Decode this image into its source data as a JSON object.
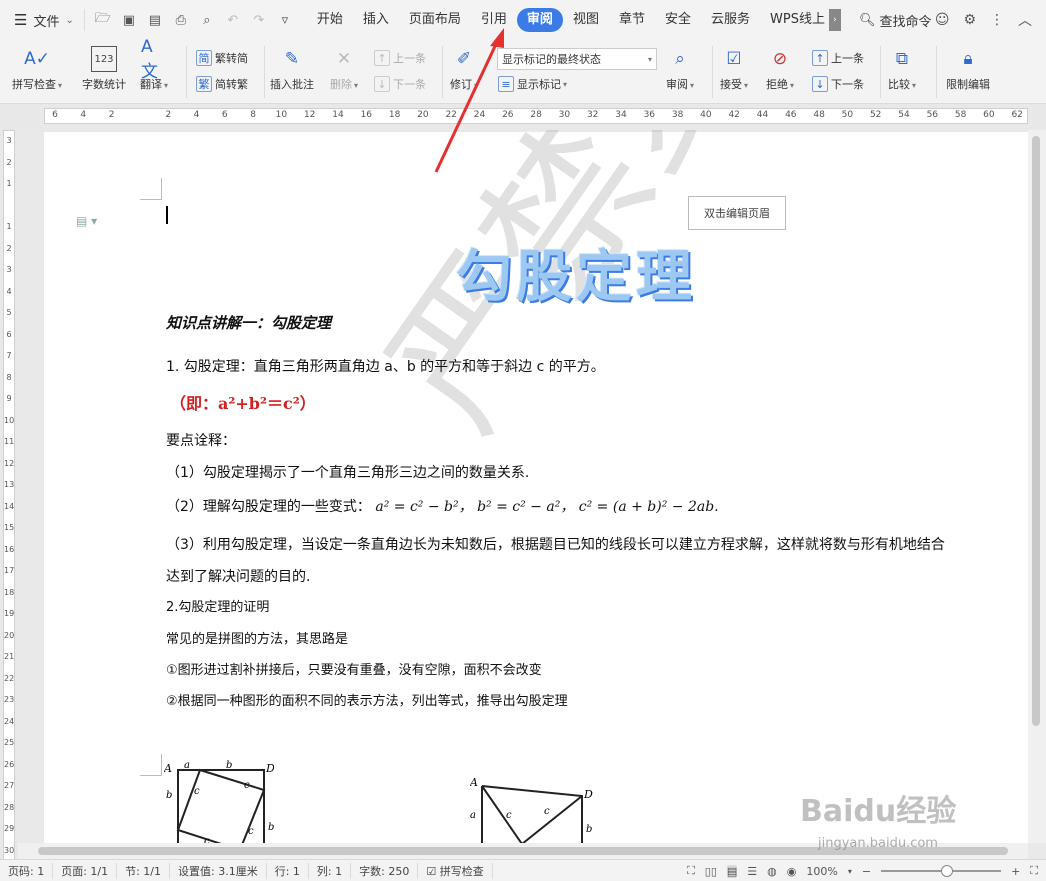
{
  "menubar": {
    "file_label": "文件",
    "tabs": [
      "开始",
      "插入",
      "页面布局",
      "引用",
      "审阅",
      "视图",
      "章节",
      "安全",
      "云服务",
      "WPS线上"
    ],
    "active_tab": "审阅",
    "search_label": "查找命令"
  },
  "ribbon": {
    "spell_check": "拼写检查",
    "word_count": "字数统计",
    "translate": "翻译",
    "trad_to_simp": "繁转简",
    "simp_to_trad": "简转繁",
    "insert_comment": "插入批注",
    "delete": "删除",
    "prev_item": "上一条",
    "next_item": "下一条",
    "track_changes": "修订",
    "display_mode": "显示标记的最终状态",
    "show_markup": "显示标记",
    "review": "审阅",
    "accept": "接受",
    "reject": "拒绝",
    "prev_change": "上一条",
    "next_change": "下一条",
    "compare": "比较",
    "restrict_edit": "限制编辑"
  },
  "ruler": {
    "h_ticks": [
      "6",
      "4",
      "2",
      "",
      "2",
      "4",
      "6",
      "8",
      "10",
      "12",
      "14",
      "16",
      "18",
      "20",
      "22",
      "24",
      "26",
      "28",
      "30",
      "32",
      "34",
      "36",
      "38",
      "40",
      "42",
      "44",
      "46",
      "48",
      "50",
      "52",
      "54",
      "56",
      "58",
      "60",
      "62"
    ],
    "v_ticks": [
      "3",
      "2",
      "1",
      "",
      "1",
      "2",
      "3",
      "4",
      "5",
      "6",
      "7",
      "8",
      "9",
      "10",
      "11",
      "12",
      "13",
      "14",
      "15",
      "16",
      "17",
      "18",
      "19",
      "20",
      "21",
      "22",
      "23",
      "24",
      "25",
      "26",
      "27",
      "28",
      "29",
      "30"
    ]
  },
  "document": {
    "header_button": "双击编辑页眉",
    "title": "勾股定理",
    "heading": "知识点讲解一：勾股定理",
    "p1": "1. 勾股定理：直角三角形两直角边 a、b 的平方和等于斜边 c 的平方。",
    "formula": "（即：a²+b²＝c²）",
    "notes_title": "要点诠释：",
    "note1": "（1）勾股定理揭示了一个直角三角形三边之间的数量关系.",
    "note2_prefix": "（2）理解勾股定理的一些变式：",
    "note2_math": "a² = c² − b²，  b² = c² − a²，   c² = (a + b)² − 2ab.",
    "note3_line1": "（3）利用勾股定理，当设定一条直角边长为未知数后，根据题目已知的线段长可以建立方程求解，这样就将数与形有机地结合",
    "note3_line2": "达到了解决问题的目的.",
    "p2": "2.勾股定理的证明",
    "p3": "常见的是拼图的方法，其思路是",
    "p4": "①图形进过割补拼接后，只要没有重叠，没有空隙，面积不会改变",
    "p5": "②根据同一种图形的面积不同的表示方法，列出等式，推导出勾股定理",
    "watermark": "严禁复制",
    "fig1_labels": [
      "A",
      "a",
      "b",
      "D",
      "b",
      "c",
      "c",
      "c",
      "c",
      "b",
      "a"
    ],
    "fig2_labels": [
      "A",
      "D",
      "a",
      "c",
      "c",
      "b"
    ]
  },
  "statusbar": {
    "page_num": "页码: 1",
    "pages": "页面: 1/1",
    "section": "节: 1/1",
    "setting": "设置值: 3.1厘米",
    "row": "行: 1",
    "col": "列: 1",
    "word_count": "字数: 250",
    "spell_check": "拼写检查",
    "zoom": "100%"
  },
  "overlay": {
    "baidu_logo": "Baidu经验",
    "baidu_url": "jingyan.baidu.com"
  },
  "colors": {
    "accent": "#3b7be6",
    "formula_red": "#d02020",
    "arrow_red": "#e53030"
  }
}
